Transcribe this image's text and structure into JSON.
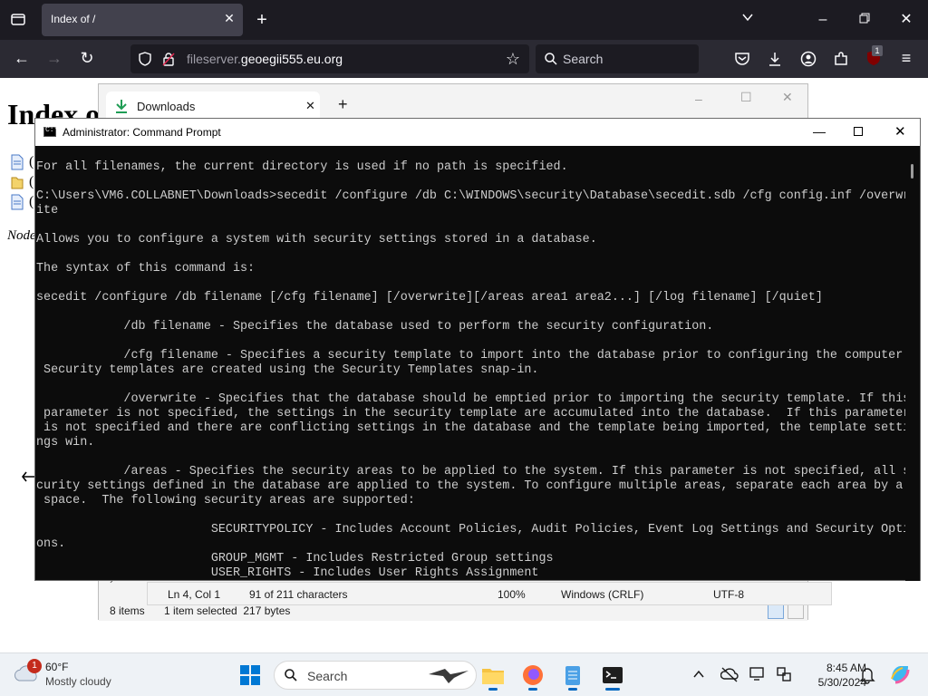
{
  "browser": {
    "tab_title": "Index of /",
    "url_prefix": "fileserver.",
    "url_host": "geoegii555.eu.org",
    "search_placeholder": "Search",
    "extension_badge": "1"
  },
  "page": {
    "heading": "Index o",
    "files": [
      {
        "icon": "document-icon",
        "text": "("
      },
      {
        "icon": "folder-icon",
        "text": "("
      },
      {
        "icon": "document-icon",
        "text": "("
      }
    ],
    "footer": "Node"
  },
  "explorer": {
    "tab_title": "Downloads",
    "status_items": "8 items",
    "status_selected": "1 item selected  217 bytes"
  },
  "notepad": {
    "position": "Ln 4, Col 1",
    "chars": "91 of 211 characters",
    "zoom": "100%",
    "line_ending": "Windows (CRLF)",
    "encoding": "UTF-8"
  },
  "cmd": {
    "title": "Administrator: Command Prompt",
    "lines": [
      "For all filenames, the current directory is used if no path is specified.",
      "",
      "C:\\Users\\VM6.COLLABNET\\Downloads>secedit /configure /db C:\\WINDOWS\\security\\Database\\secedit.sdb /cfg config.inf /overwr",
      "ite",
      "",
      "Allows you to configure a system with security settings stored in a database.",
      "",
      "The syntax of this command is:",
      "",
      "secedit /configure /db filename [/cfg filename] [/overwrite][/areas area1 area2...] [/log filename] [/quiet]",
      "",
      "            /db filename - Specifies the database used to perform the security configuration.",
      "",
      "            /cfg filename - Specifies a security template to import into the database prior to configuring the computer.",
      " Security templates are created using the Security Templates snap-in.",
      "",
      "            /overwrite - Specifies that the database should be emptied prior to importing the security template. If this",
      " parameter is not specified, the settings in the security template are accumulated into the database.  If this parameter",
      " is not specified and there are conflicting settings in the database and the template being imported, the template setti",
      "ngs win.",
      "",
      "            /areas - Specifies the security areas to be applied to the system. If this parameter is not specified, all se",
      "curity settings defined in the database are applied to the system. To configure multiple areas, separate each area by a",
      " space.  The following security areas are supported:",
      "",
      "                        SECURITYPOLICY - Includes Account Policies, Audit Policies, Event Log Settings and Security Opti",
      "ons.",
      "                        GROUP_MGMT - Includes Restricted Group settings",
      "                        USER_RIGHTS - Includes User Rights Assignment"
    ]
  },
  "taskbar": {
    "weather_badge": "1",
    "temperature": "60°F",
    "condition": "Mostly cloudy",
    "search_label": "Search",
    "time": "8:45 AM",
    "date": "5/30/2024"
  }
}
